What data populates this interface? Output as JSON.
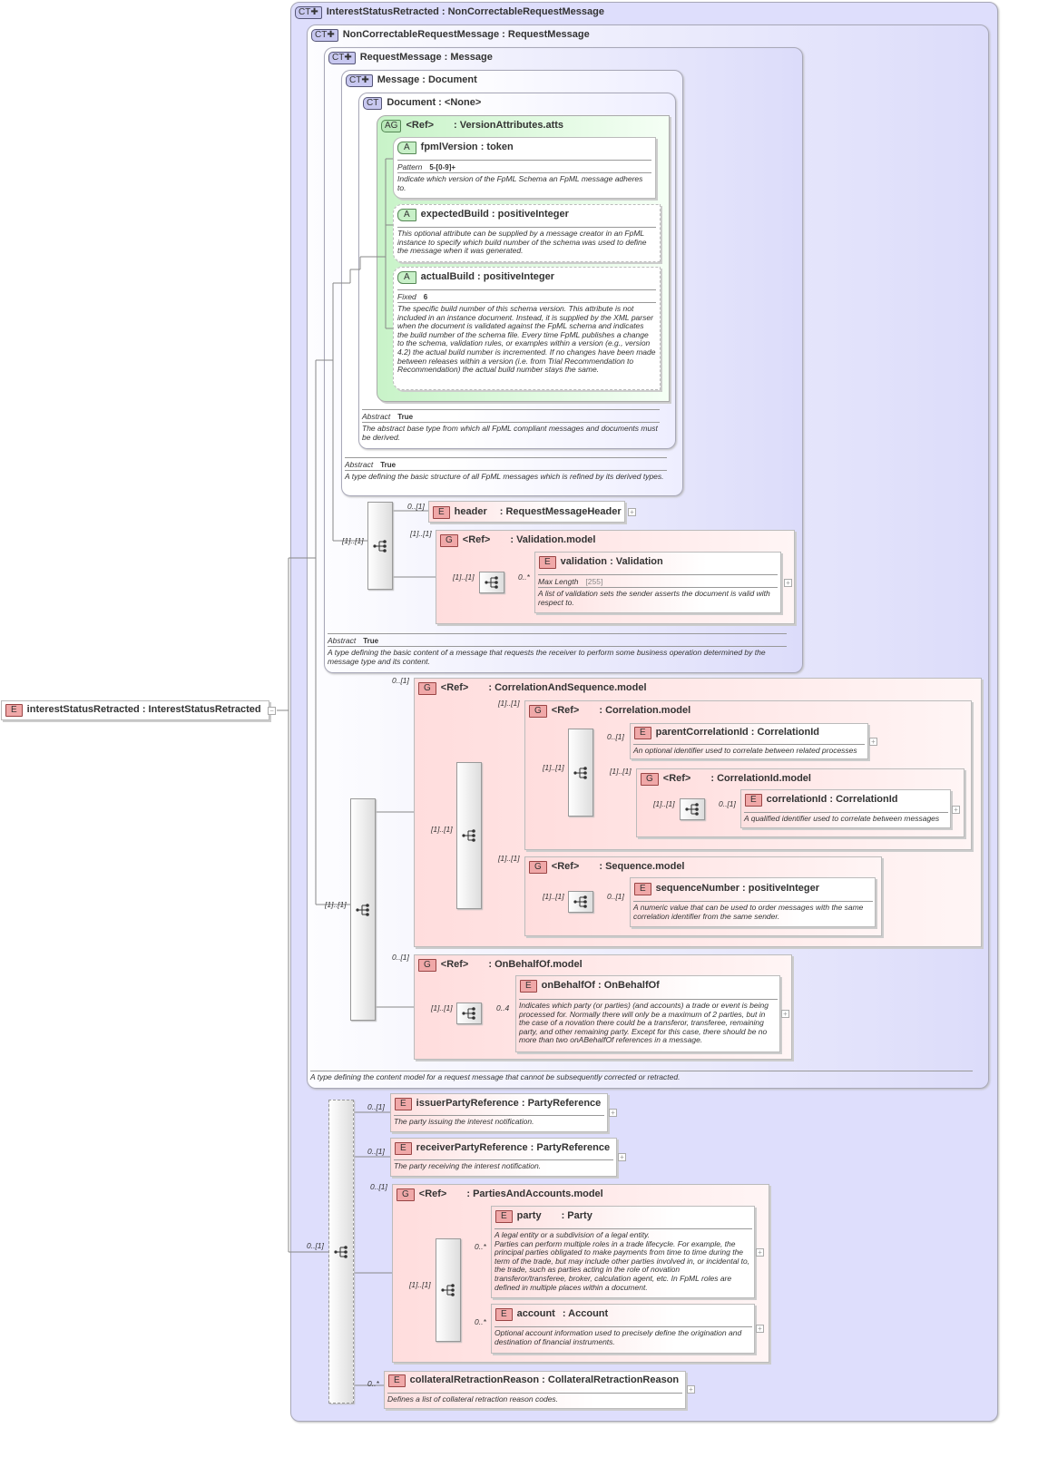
{
  "root": {
    "badge": "E",
    "name": "interestStatusRetracted",
    "type": ": InterestStatusRetracted"
  },
  "ct1": {
    "badge": "CT✚",
    "title": "InterestStatusRetracted : NonCorrectableRequestMessage"
  },
  "ct2": {
    "badge": "CT✚",
    "title": "NonCorrectableRequestMessage : RequestMessage",
    "desc": "A type defining the content model for a request message that cannot be subsequently corrected or retracted."
  },
  "ct3": {
    "badge": "CT✚",
    "title": "RequestMessage : Message",
    "abstract_label": "Abstract",
    "abstract_value": "True",
    "desc": "A type defining the basic content of a message that requests the receiver to perform some business operation determined by the message type and its content."
  },
  "ct4": {
    "badge": "CT✚",
    "title": "Message : Document",
    "abstract_label": "Abstract",
    "abstract_value": "True",
    "desc": "A type defining the basic structure of all FpML messages which is refined by its derived types."
  },
  "ct5": {
    "badge": "CT",
    "title": "Document : <None>",
    "abstract_label": "Abstract",
    "abstract_value": "True",
    "desc": "The abstract base type from which all FpML compliant messages and documents must be derived."
  },
  "ag": {
    "badge": "AG",
    "ref": "<Ref>",
    "title": ": VersionAttributes.atts"
  },
  "fpmlVersion": {
    "badge": "A",
    "title": "fpmlVersion : token",
    "prop_label": "Pattern",
    "prop_value": "5-[0-9]+",
    "desc": "Indicate which version of the FpML Schema an FpML message adheres to."
  },
  "expectedBuild": {
    "badge": "A",
    "title": "expectedBuild : positiveInteger",
    "desc": "This optional attribute can be supplied by a message creator in an FpML instance to specify which build number of the schema was used to define the message when it was generated."
  },
  "actualBuild": {
    "badge": "A",
    "title": "actualBuild : positiveInteger",
    "prop_label": "Fixed",
    "prop_value": "6",
    "desc": "The specific build number of this schema version. This attribute is not included in an instance document. Instead, it is supplied by the XML parser when the document is validated against the FpML schema and indicates the build number of the schema file. Every time FpML publishes a change to the schema, validation rules, or examples within a version (e.g., version 4.2) the actual build number is incremented. If no changes have been made between releases within a version (i.e. from Trial Recommendation to Recommendation) the actual build number stays the same."
  },
  "header": {
    "badge": "E",
    "name": "header",
    "type": ": RequestMessageHeader",
    "card": "0..[1]"
  },
  "validationModel": {
    "badge": "G",
    "ref": "<Ref>",
    "title": ": Validation.model",
    "card": "[1]..[1]",
    "seq_card": "[1]..[1]"
  },
  "validation": {
    "badge": "E",
    "title": "validation : Validation",
    "card": "0..*",
    "prop_label": "Max Length",
    "prop_value": "[255]",
    "desc": "A list of validation sets the sender asserts the document is valid with respect to."
  },
  "seq_ct3_card": "[1]..[1]",
  "corrSeqModel": {
    "badge": "G",
    "ref": "<Ref>",
    "title": ": CorrelationAndSequence.model",
    "card": "0..[1]",
    "seq_card": "[1]..[1]"
  },
  "correlationModel": {
    "badge": "G",
    "ref": "<Ref>",
    "title": ": Correlation.model",
    "card": "[1]..[1]",
    "seq_card": "[1]..[1]"
  },
  "parentCorrelationId": {
    "badge": "E",
    "title": "parentCorrelationId : CorrelationId",
    "card": "0..[1]",
    "desc": "An optional identifier used to correlate between related processes"
  },
  "correlationIdModel": {
    "badge": "G",
    "ref": "<Ref>",
    "title": ": CorrelationId.model",
    "card": "[1]..[1]",
    "seq_card": "[1]..[1]"
  },
  "correlationId": {
    "badge": "E",
    "title": "correlationId : CorrelationId",
    "card": "0..[1]",
    "desc": "A qualified identifier used to correlate between messages"
  },
  "sequenceModel": {
    "badge": "G",
    "ref": "<Ref>",
    "title": ": Sequence.model",
    "card": "[1]..[1]",
    "seq_card": "[1]..[1]"
  },
  "sequenceNumber": {
    "badge": "E",
    "title": "sequenceNumber : positiveInteger",
    "card": "0..[1]",
    "desc": "A numeric value that can be used to order messages with the same correlation identifier from the same sender."
  },
  "seq_ct2_card": "[1]..[1]",
  "onBehalfOfModel": {
    "badge": "G",
    "ref": "<Ref>",
    "title": ": OnBehalfOf.model",
    "card": "0..[1]",
    "seq_card": "[1]..[1]"
  },
  "onBehalfOf": {
    "badge": "E",
    "title": "onBehalfOf : OnBehalfOf",
    "card": "0..4",
    "desc": "Indicates which party (or parties) (and accounts) a trade or event is being processed for. Normally there will only be a maximum of 2 parties, but in the case of a novation there could be a transferor, transferee, remaining party, and other remaining party. Except for this case, there should be no more than two onABehalfOf references in a message."
  },
  "seq_bottom_card": "0..[1]",
  "issuerPartyReference": {
    "badge": "E",
    "title": "issuerPartyReference : PartyReference",
    "card": "0..[1]",
    "desc": "The party issuing the interest notification."
  },
  "receiverPartyReference": {
    "badge": "E",
    "title": "receiverPartyReference : PartyReference",
    "card": "0..[1]",
    "desc": "The party receiving the interest notification."
  },
  "partiesModel": {
    "badge": "G",
    "ref": "<Ref>",
    "title": ": PartiesAndAccounts.model",
    "card": "0..[1]",
    "seq_card": "[1]..[1]"
  },
  "party": {
    "badge": "E",
    "name": "party",
    "type": ": Party",
    "card": "0..*",
    "desc": "A legal entity or a subdivision of a legal entity.\nParties can perform multiple roles in a trade lifecycle. For example, the principal parties obligated to make payments from time to time during the term of the trade, but may include other parties involved in, or incidental to, the trade, such as parties acting in the role of novation transferor/transferee, broker, calculation agent, etc. In FpML roles are defined in multiple places within a document."
  },
  "account": {
    "badge": "E",
    "name": "account",
    "type": ": Account",
    "card": "0..*",
    "desc": "Optional account information used to precisely define the origination and destination of financial instruments."
  },
  "collateralRetractionReason": {
    "badge": "E",
    "title": "collateralRetractionReason : CollateralRetractionReason",
    "card": "0..*",
    "desc": "Defines a list of collateral retraction reason codes."
  }
}
